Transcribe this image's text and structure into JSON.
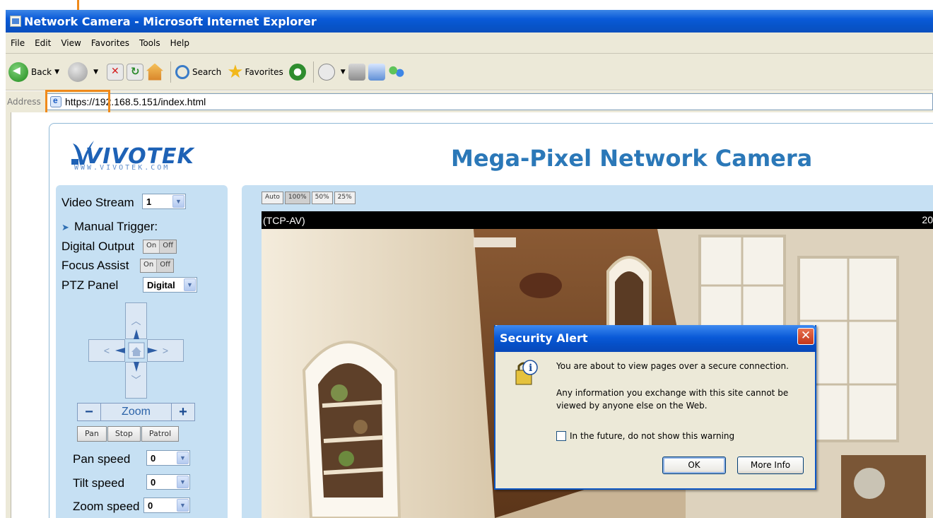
{
  "window": {
    "title": "Network Camera - Microsoft Internet Explorer"
  },
  "menu": [
    "File",
    "Edit",
    "View",
    "Favorites",
    "Tools",
    "Help"
  ],
  "toolbar": {
    "back_label": "Back",
    "search_label": "Search",
    "favorites_label": "Favorites"
  },
  "address": {
    "label": "Address",
    "url": "https://192.168.5.151/index.html"
  },
  "page": {
    "logo_text": "VIVOTEK",
    "logo_url": "WWW.VIVOTEK.COM",
    "title": "Mega-Pixel Network Camera"
  },
  "controls": {
    "video_stream_label": "Video Stream",
    "video_stream_value": "1",
    "manual_trigger_label": "Manual Trigger:",
    "digital_output_label": "Digital Output",
    "focus_assist_label": "Focus Assist",
    "on_label": "On",
    "off_label": "Off",
    "ptz_panel_label": "PTZ Panel",
    "ptz_panel_value": "Digital",
    "zoom_label": "Zoom",
    "zoom_minus": "−",
    "zoom_plus": "+",
    "pan_button": "Pan",
    "stop_button": "Stop",
    "patrol_button": "Patrol",
    "pan_speed_label": "Pan speed",
    "pan_speed_value": "0",
    "tilt_speed_label": "Tilt speed",
    "tilt_speed_value": "0",
    "zoom_speed_label": "Zoom speed",
    "zoom_speed_value": "0"
  },
  "video": {
    "size_buttons": [
      "Auto",
      "100%",
      "50%",
      "25%"
    ],
    "protocol": "(TCP-AV)",
    "timestamp_partial": "20"
  },
  "dialog": {
    "title": "Security Alert",
    "line1": "You are about to view pages over a secure connection.",
    "line2": "Any information you exchange with this site cannot be",
    "line3": "viewed by anyone else on the Web.",
    "checkbox_label": "In the future, do not show this warning",
    "checkbox_checked": false,
    "ok_button": "OK",
    "more_info_button": "More Info"
  },
  "colors": {
    "callout": "#f08a1a",
    "panel_bg": "#c6e0f3",
    "title_blue": "#2b78b8"
  }
}
